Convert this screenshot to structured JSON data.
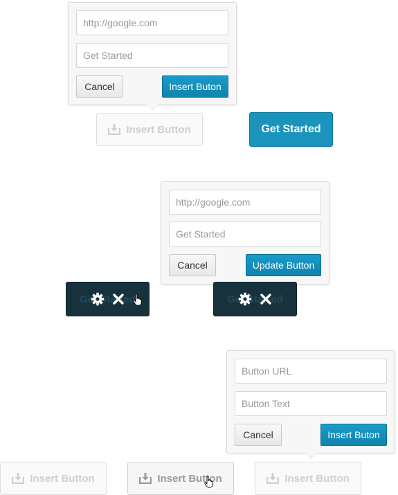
{
  "popover_top": {
    "url_placeholder": "http://google.com",
    "text_placeholder": "Get Started",
    "cancel_label": "Cancel",
    "submit_label": "Insert Buton"
  },
  "insert_button_top": {
    "label": "Insert Button",
    "icon": "download-icon"
  },
  "result_button": {
    "label": "Get Started"
  },
  "popover_middle": {
    "url_placeholder": "http://google.com",
    "text_placeholder": "Get Started",
    "cancel_label": "Cancel",
    "submit_label": "Update Button"
  },
  "edit_button_left": {
    "label": "Get Started",
    "icons": [
      "gear-icon",
      "close-icon"
    ]
  },
  "edit_button_right": {
    "label": "Get Started",
    "icons": [
      "gear-icon",
      "close-icon"
    ]
  },
  "popover_bottom": {
    "url_placeholder": "Button URL",
    "text_placeholder": "Button Text",
    "cancel_label": "Cancel",
    "submit_label": "Insert Buton"
  },
  "insert_buttons_bottom": [
    {
      "label": "Insert Button",
      "state": "idle"
    },
    {
      "label": "Insert Button",
      "state": "hover"
    },
    {
      "label": "Insert Button",
      "state": "idle"
    }
  ],
  "colors": {
    "primary": "#1a94bd",
    "dark_overlay": "#17323c",
    "popover_bg": "#f7f7f7"
  }
}
